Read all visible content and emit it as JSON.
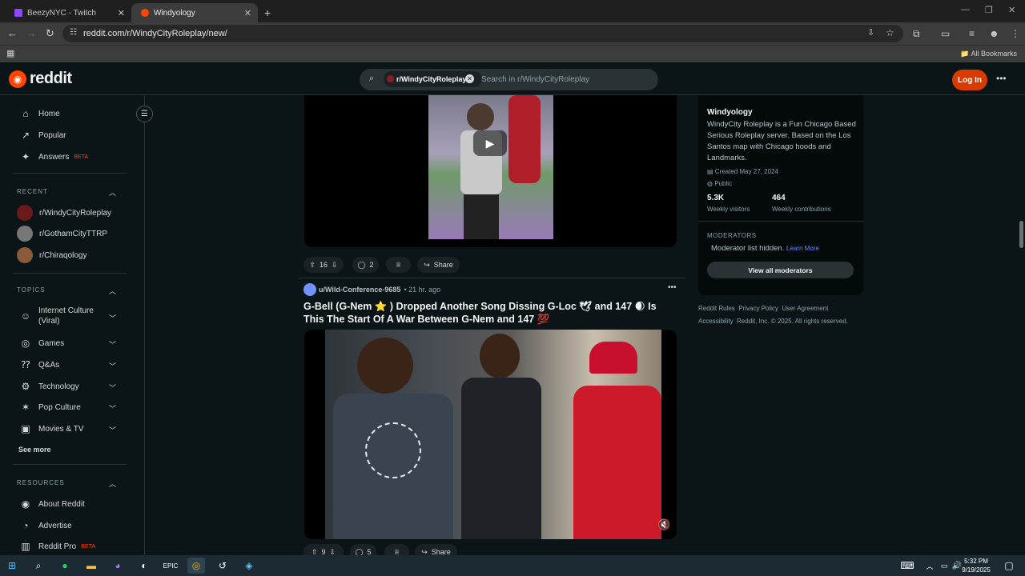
{
  "browser": {
    "tabs": [
      {
        "title": "BeezyNYC - Twitch",
        "active": false
      },
      {
        "title": "Windyology",
        "active": true
      }
    ],
    "url": "reddit.com/r/WindyCityRoleplay/new/",
    "bookmarks_label": "All Bookmarks"
  },
  "header": {
    "logo_text": "reddit",
    "search_chip": "r/WindyCityRoleplay",
    "search_placeholder": "Search in r/WindyCityRoleplay",
    "login_label": "Log In"
  },
  "sidebar": {
    "main": [
      {
        "label": "Home",
        "icon": "home-icon"
      },
      {
        "label": "Popular",
        "icon": "popular-icon"
      },
      {
        "label": "Answers",
        "icon": "answers-icon",
        "badge": "BETA"
      }
    ],
    "recent_title": "RECENT",
    "recent": [
      "r/WindyCityRoleplay",
      "r/GothamCityTTRP",
      "r/Chiraqology"
    ],
    "topics_title": "TOPICS",
    "topics": [
      "Internet Culture (Viral)",
      "Games",
      "Q&As",
      "Technology",
      "Pop Culture",
      "Movies & TV"
    ],
    "see_more": "See more",
    "resources_title": "RESOURCES",
    "resources": [
      {
        "label": "About Reddit",
        "icon": "about-icon"
      },
      {
        "label": "Advertise",
        "icon": "advertise-icon"
      },
      {
        "label": "Reddit Pro",
        "icon": "reddit-pro-icon",
        "badge": "BETA"
      }
    ]
  },
  "feed": {
    "post1": {
      "upvotes": "16",
      "comments": "2",
      "share": "Share"
    },
    "post2": {
      "author": "u/Wild-Conference-9685",
      "time": "• 21 hr. ago",
      "title": "G-Bell (G-Nem ⭐ ) Dropped Another Song Dissing G-Loc 🕊 and 147 🌒 Is This The Start Of A War Between G-Nem and 147 💯",
      "upvotes": "9",
      "comments": "5",
      "share": "Share"
    }
  },
  "community": {
    "name": "Windyology",
    "description": "WindyCity Roleplay is a Fun Chicago Based Serious Roleplay server. Based on the Los Santos map with Chicago hoods and Landmarks.",
    "created": "Created May 27, 2024",
    "visibility": "Public",
    "stat1_value": "5.3K",
    "stat1_label": "Weekly visitors",
    "stat2_value": "464",
    "stat2_label": "Weekly contributions",
    "moderators_title": "MODERATORS",
    "moderators_hidden": "Moderator list hidden.",
    "learn_more": "Learn More",
    "view_all": "View all moderators"
  },
  "footer": {
    "line1": [
      "Reddit Rules",
      "Privacy Policy",
      "User Agreement"
    ],
    "line2": [
      "Accessibility",
      "Reddit, Inc. © 2025. All rights reserved."
    ]
  },
  "taskbar": {
    "time": "5:32 PM",
    "date": "9/19/2025"
  },
  "colors": {
    "accent": "#ff4500",
    "login": "#d93a00",
    "background": "#0b1416"
  }
}
